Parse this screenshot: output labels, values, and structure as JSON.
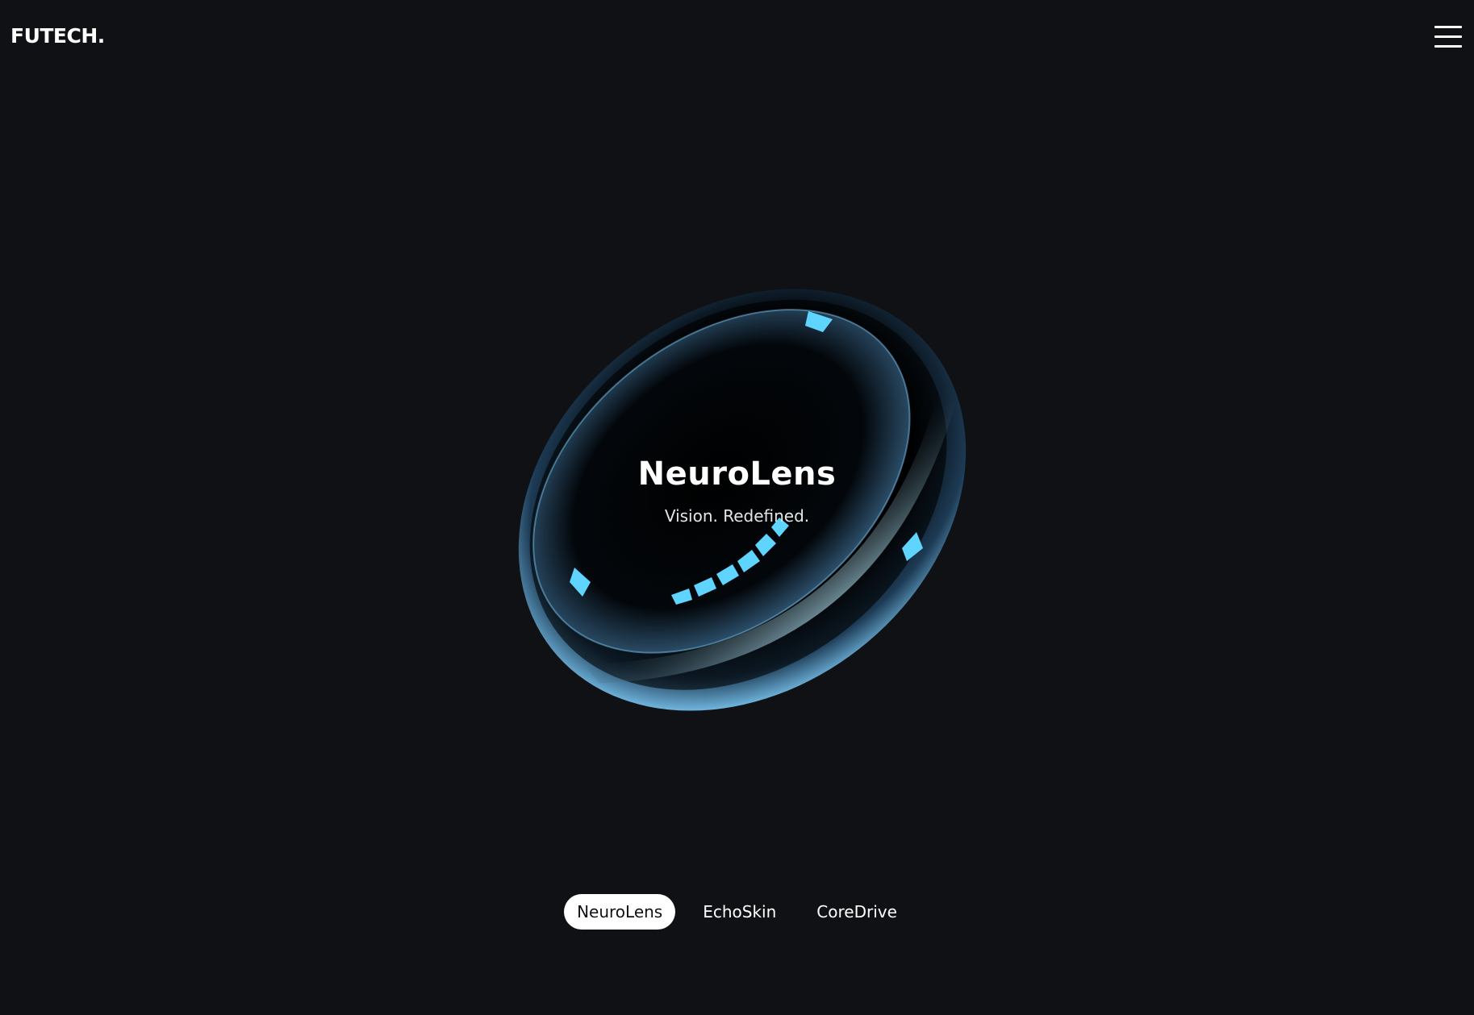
{
  "header": {
    "logo": "FUTECH.",
    "menu_icon": "hamburger-menu-icon"
  },
  "hero": {
    "title": "NeuroLens",
    "subtitle": "Vision. Redefined."
  },
  "product_tabs": [
    {
      "label": "NeuroLens",
      "active": true
    },
    {
      "label": "EchoSkin",
      "active": false
    },
    {
      "label": "CoreDrive",
      "active": false
    }
  ],
  "colors": {
    "background": "#0f1114",
    "accent": "#5fd4ff",
    "text": "#ffffff"
  }
}
